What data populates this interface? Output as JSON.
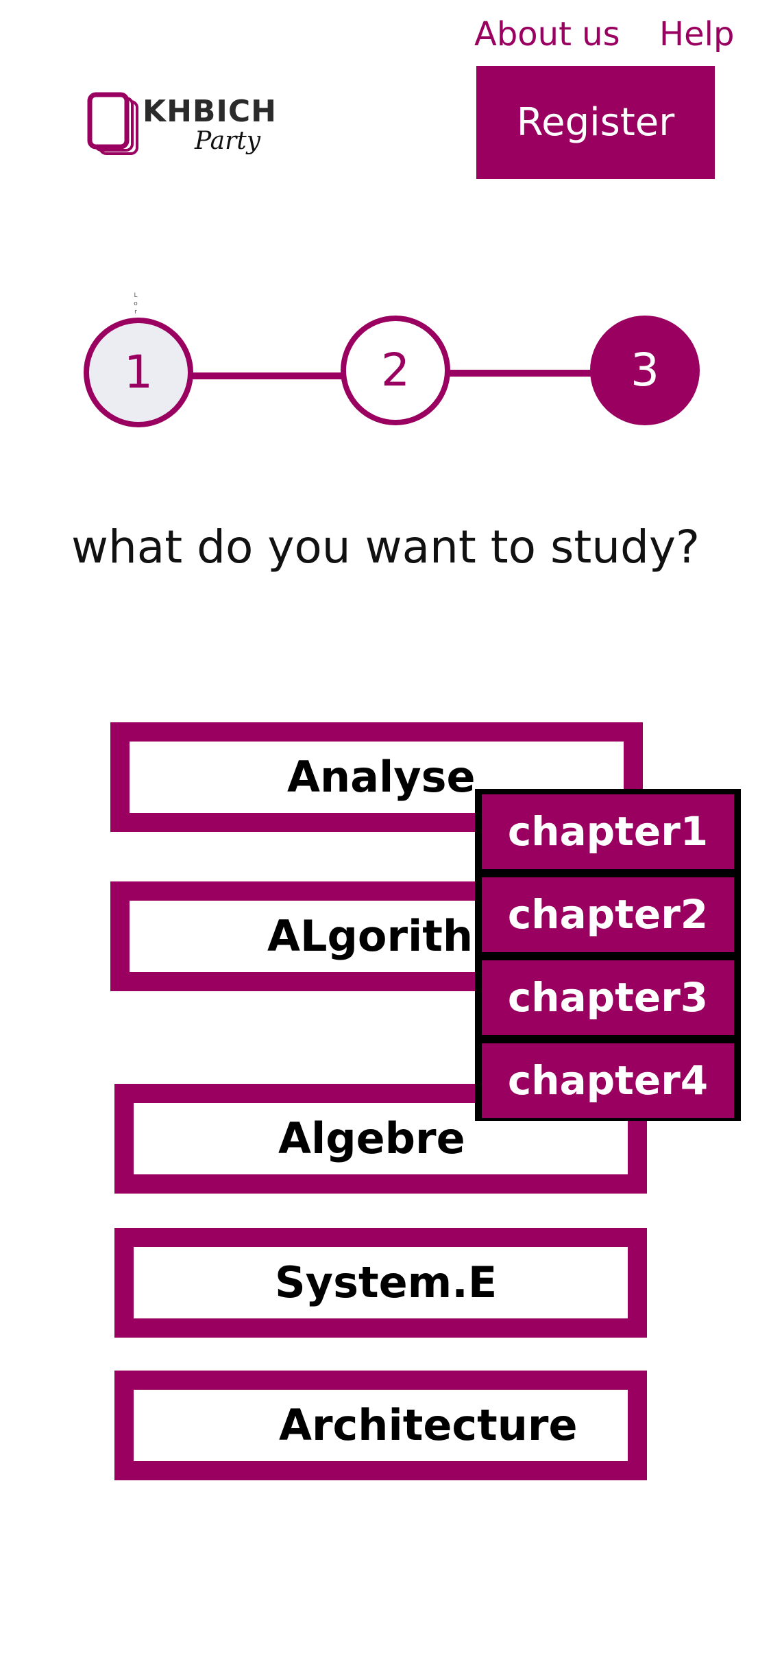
{
  "header": {
    "about_label": "About us",
    "help_label": "Help",
    "register_label": "Register",
    "logo_title": "KHBICH",
    "logo_subtitle": "Party"
  },
  "stepper": {
    "tiny_text": [
      "L",
      "o",
      "r"
    ],
    "steps": [
      "1",
      "2",
      "3"
    ],
    "active_step": 3
  },
  "question": "what do you want to study?",
  "subjects": [
    "Analyse",
    "ALgorithm",
    "Algebre",
    "System.E",
    "Architecture"
  ],
  "chapter_menu": {
    "items": [
      "chapter1",
      "chapter2",
      "chapter3",
      "chapter4"
    ]
  },
  "colors": {
    "accent": "#99005f",
    "step_inactive_fill": "#ecedf3",
    "menu_border": "#000000",
    "text": "#111111"
  },
  "icons": {
    "logo": "stacked-cards-icon"
  }
}
